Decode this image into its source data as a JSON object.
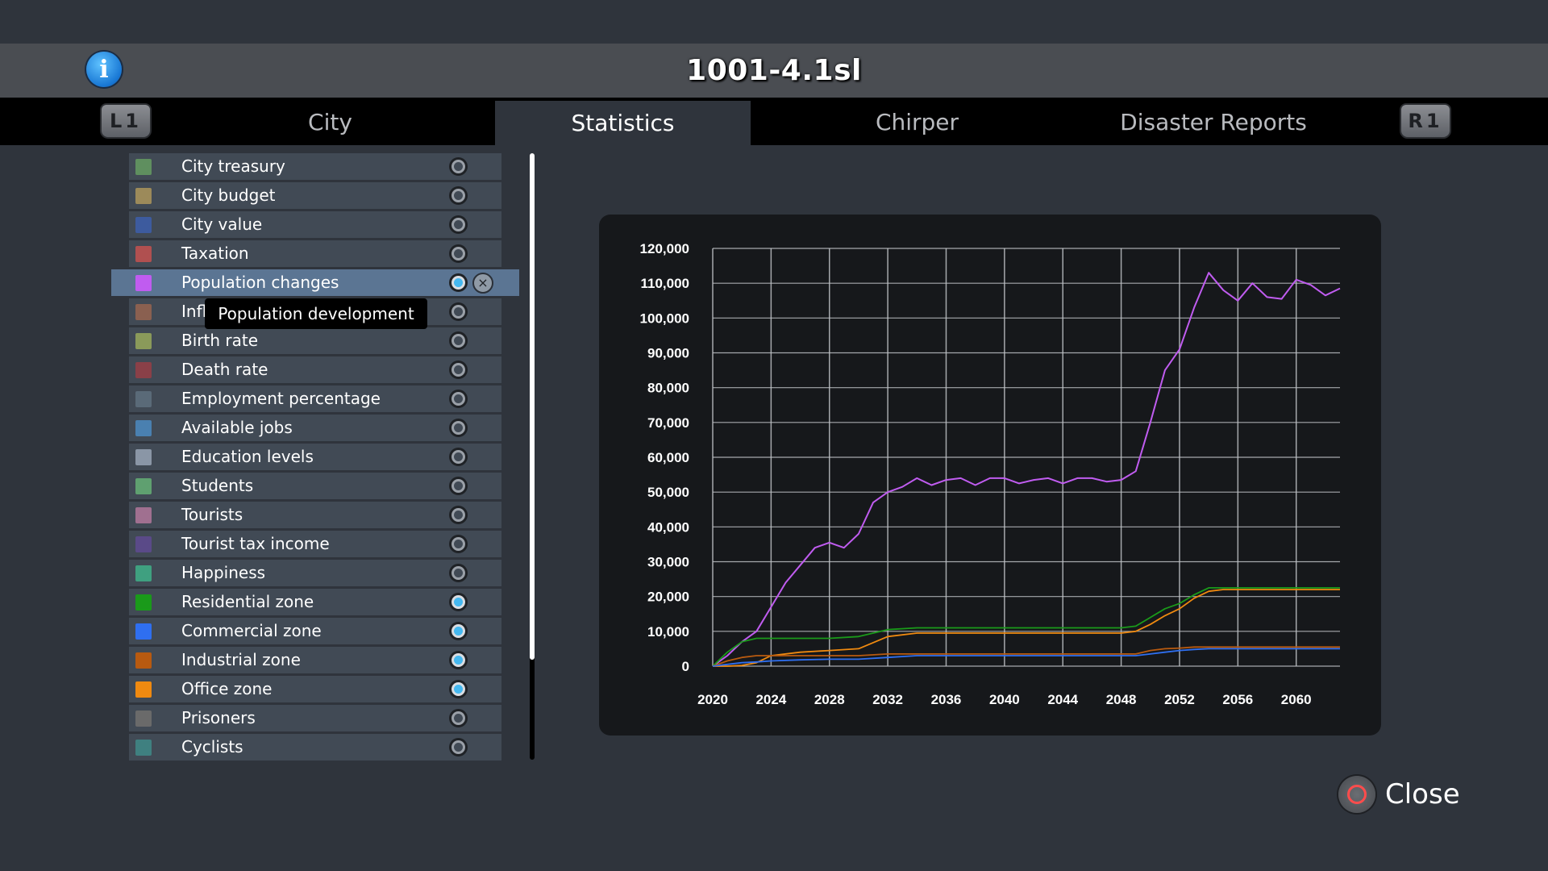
{
  "window": {
    "title": "1001-4.1sl"
  },
  "tabs": [
    {
      "label": "City"
    },
    {
      "label": "Statistics"
    },
    {
      "label": "Chirper"
    },
    {
      "label": "Disaster Reports"
    }
  ],
  "shoulder_buttons": {
    "left": "L1",
    "right": "R1"
  },
  "icons": {
    "info": "info-icon",
    "close": "circle-button-icon",
    "remove": "x-icon"
  },
  "stats": [
    {
      "label": "City treasury",
      "color": "#5f8f5f",
      "on": false
    },
    {
      "label": "City budget",
      "color": "#9c8a5a",
      "on": false
    },
    {
      "label": "City value",
      "color": "#3d5b9e",
      "on": false
    },
    {
      "label": "Taxation",
      "color": "#b05050",
      "on": false
    },
    {
      "label": "Population changes",
      "color": "#c05cf0",
      "on": true
    },
    {
      "label": "Infl",
      "color": "#8a6050",
      "on": false
    },
    {
      "label": "Birth rate",
      "color": "#8a9a5a",
      "on": false
    },
    {
      "label": "Death rate",
      "color": "#8a4048",
      "on": false
    },
    {
      "label": "Employment percentage",
      "color": "#5a6a78",
      "on": false
    },
    {
      "label": "Available jobs",
      "color": "#4a80b0",
      "on": false
    },
    {
      "label": "Education levels",
      "color": "#8a96a6",
      "on": false
    },
    {
      "label": "Students",
      "color": "#5fa070",
      "on": false
    },
    {
      "label": "Tourists",
      "color": "#a07090",
      "on": false
    },
    {
      "label": "Tourist tax income",
      "color": "#5a4a88",
      "on": false
    },
    {
      "label": "Happiness",
      "color": "#3fa080",
      "on": false
    },
    {
      "label": "Residential zone",
      "color": "#1a9a1a",
      "on": true
    },
    {
      "label": "Commercial zone",
      "color": "#2f6ff0",
      "on": true
    },
    {
      "label": "Industrial zone",
      "color": "#b85a10",
      "on": true
    },
    {
      "label": "Office zone",
      "color": "#f08a10",
      "on": true
    },
    {
      "label": "Prisoners",
      "color": "#6a6a6a",
      "on": false
    },
    {
      "label": "Cyclists",
      "color": "#3f8080",
      "on": false
    }
  ],
  "tooltip": "Population development",
  "close_label": "Close",
  "chart_data": {
    "type": "line",
    "title": "",
    "xlabel": "",
    "ylabel": "",
    "xlim": [
      2020,
      2063
    ],
    "ylim": [
      0,
      120000
    ],
    "grid": true,
    "x_ticks": [
      "2020",
      "2024",
      "2028",
      "2032",
      "2036",
      "2040",
      "2044",
      "2048",
      "2052",
      "2056",
      "2060"
    ],
    "y_ticks": [
      "0",
      "10,000",
      "20,000",
      "30,000",
      "40,000",
      "50,000",
      "60,000",
      "70,000",
      "80,000",
      "90,000",
      "100,000",
      "110,000",
      "120,000"
    ],
    "series": [
      {
        "color": "#c05cf0",
        "x": [
          2020,
          2021,
          2022,
          2023,
          2024,
          2025,
          2026,
          2027,
          2028,
          2029,
          2030,
          2031,
          2032,
          2033,
          2034,
          2035,
          2036,
          2037,
          2038,
          2039,
          2040,
          2041,
          2042,
          2043,
          2044,
          2045,
          2046,
          2047,
          2048,
          2049,
          2050,
          2051,
          2052,
          2053,
          2054,
          2055,
          2056,
          2057,
          2058,
          2059,
          2060,
          2061,
          2062,
          2063
        ],
        "values": [
          0,
          3000,
          7000,
          10000,
          17000,
          24000,
          29000,
          34000,
          35500,
          34000,
          38000,
          47000,
          50000,
          51500,
          54000,
          52000,
          53500,
          54000,
          52000,
          54000,
          54000,
          52500,
          53500,
          54000,
          52500,
          54000,
          54000,
          53000,
          53500,
          56000,
          70000,
          85000,
          91000,
          103000,
          113000,
          108000,
          105000,
          110000,
          106000,
          105500,
          111000,
          109500,
          106500,
          108500
        ]
      },
      {
        "color": "#1a9a1a",
        "x": [
          2020,
          2021,
          2022,
          2023,
          2024,
          2026,
          2028,
          2030,
          2032,
          2034,
          2040,
          2044,
          2048,
          2049,
          2050,
          2051,
          2052,
          2053,
          2054,
          2055,
          2058,
          2063
        ],
        "values": [
          0,
          4000,
          7000,
          8000,
          8000,
          8000,
          8000,
          8500,
          10500,
          11000,
          11000,
          11000,
          11000,
          11500,
          14000,
          16500,
          18000,
          20500,
          22500,
          22500,
          22500,
          22500
        ]
      },
      {
        "color": "#f08a10",
        "x": [
          2020,
          2021,
          2022,
          2023,
          2024,
          2026,
          2028,
          2030,
          2032,
          2034,
          2040,
          2044,
          2048,
          2049,
          2050,
          2051,
          2052,
          2053,
          2054,
          2055,
          2058,
          2063
        ],
        "values": [
          0,
          0,
          200,
          1000,
          3000,
          4000,
          4500,
          5000,
          8500,
          9500,
          9500,
          9500,
          9500,
          10000,
          12000,
          14500,
          16500,
          19500,
          21500,
          22000,
          22000,
          22000
        ]
      },
      {
        "color": "#b85a10",
        "x": [
          2020,
          2021,
          2022,
          2023,
          2024,
          2026,
          2028,
          2030,
          2032,
          2034,
          2040,
          2044,
          2048,
          2049,
          2050,
          2051,
          2052,
          2053,
          2054,
          2058,
          2063
        ],
        "values": [
          0,
          1500,
          2500,
          3000,
          3000,
          3000,
          3000,
          3000,
          3500,
          3500,
          3500,
          3500,
          3500,
          3500,
          4500,
          5000,
          5200,
          5500,
          5500,
          5500,
          5500
        ]
      },
      {
        "color": "#2f6ff0",
        "x": [
          2020,
          2021,
          2022,
          2023,
          2024,
          2026,
          2028,
          2030,
          2032,
          2034,
          2040,
          2044,
          2048,
          2049,
          2050,
          2051,
          2052,
          2053,
          2054,
          2058,
          2063
        ],
        "values": [
          0,
          500,
          1000,
          1200,
          1500,
          1800,
          2000,
          2000,
          2500,
          3000,
          3000,
          3000,
          3000,
          3000,
          3500,
          4000,
          4500,
          4800,
          5000,
          5000,
          5000
        ]
      }
    ]
  }
}
